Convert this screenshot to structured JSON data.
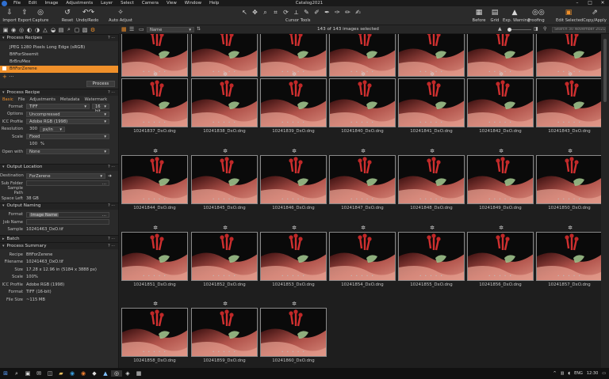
{
  "window": {
    "title": "Catalog2021"
  },
  "menu": [
    "File",
    "Edit",
    "Image",
    "Adjustments",
    "Layer",
    "Select",
    "Camera",
    "View",
    "Window",
    "Help"
  ],
  "toolbar": {
    "left": [
      {
        "label": "Import",
        "icon": "import-icon"
      },
      {
        "label": "Export",
        "icon": "export-icon"
      },
      {
        "label": "Capture",
        "icon": "capture-icon"
      },
      {
        "label": "Reset",
        "icon": "reset-icon"
      },
      {
        "label": "Undo/Redo",
        "icon": "undo-icon"
      },
      {
        "label": "Auto Adjust",
        "icon": "auto-adjust-icon"
      }
    ],
    "cursor_tools_label": "Cursor Tools",
    "right": [
      {
        "label": "Before",
        "icon": "before-icon"
      },
      {
        "label": "Grid",
        "icon": "grid-icon"
      },
      {
        "label": "Exp. Warning",
        "icon": "warning-icon"
      },
      {
        "label": "Proofing",
        "icon": "proofing-icon"
      },
      {
        "label": "Edit Selected",
        "icon": "edit-selected-icon"
      },
      {
        "label": "Copy/Apply",
        "icon": "copy-apply-icon"
      }
    ]
  },
  "browser": {
    "sort": "Name",
    "count": "143 of 143 images selected",
    "search_placeholder": "Search 30 November 2021 1"
  },
  "process_recipes": {
    "title": "Process Recipes",
    "items": [
      "JPEG 1280 Pixels Long Edge (sRGB)",
      "BfiForSteemit",
      "BrBruMex",
      "BfiForZerene"
    ],
    "selected_index": 3,
    "process_label": "Process"
  },
  "process_recipe": {
    "title": "Process Recipe",
    "tabs": [
      "Basic",
      "File",
      "Adjustments",
      "Metadata",
      "Watermark"
    ],
    "format_label": "Format",
    "format": "TIFF",
    "bit_depth": "16 bit",
    "options_label": "Options",
    "options": "Uncompressed",
    "icc_label": "ICC Profile",
    "icc": "Adobe RGB (1998)",
    "resolution_label": "Resolution",
    "resolution": "300",
    "resolution_unit": "px/in",
    "scale_label": "Scale",
    "scale": "Fixed",
    "scale_pct": "100",
    "scale_pct_unit": "%",
    "open_with_label": "Open with",
    "open_with": "None"
  },
  "output_location": {
    "title": "Output Location",
    "destination_label": "Destination",
    "destination": "ForZerene",
    "sub_folder_label": "Sub Folder",
    "sample_path_label": "Sample Path",
    "space_left_label": "Space Left",
    "space_left": "38 GB"
  },
  "output_naming": {
    "title": "Output Naming",
    "format_label": "Format",
    "format_token": "Image Name",
    "job_name_label": "Job Name",
    "sample_label": "Sample",
    "sample": "10241463_DxO.tif"
  },
  "batch": {
    "title": "Batch"
  },
  "process_summary": {
    "title": "Process Summary",
    "rows": [
      {
        "label": "Recipe",
        "value": "BfiForZerene"
      },
      {
        "label": "Filename",
        "value": "10241463_DxO.tif"
      },
      {
        "label": "Size",
        "value": "17.28 x 12.96 in (5184 x 3888 px)"
      },
      {
        "label": "Scale",
        "value": "100%"
      },
      {
        "label": "ICC Profile",
        "value": "Adobe RGB (1998)"
      },
      {
        "label": "Format",
        "value": "TIFF (16-bit)"
      },
      {
        "label": "File Size",
        "value": "~115 MB"
      }
    ]
  },
  "thumbs": [
    [
      "10241830_DxO.dng",
      "10241831_DxO.dng",
      "10241832_DxO.dng",
      "10241833_DxO.dng",
      "10241834_DxO.dng",
      "10241835_DxO.dng",
      "10241836_DxO.dng"
    ],
    [
      "10241837_DxO.dng",
      "10241838_DxO.dng",
      "10241839_DxO.dng",
      "10241840_DxO.dng",
      "10241841_DxO.dng",
      "10241842_DxO.dng",
      "10241843_DxO.dng"
    ],
    [
      "10241844_DxO.dng",
      "10241845_DxO.dng",
      "10241846_DxO.dng",
      "10241847_DxO.dng",
      "10241848_DxO.dng",
      "10241849_DxO.dng",
      "10241850_DxO.dng"
    ],
    [
      "10241851_DxO.dng",
      "10241852_DxO.dng",
      "10241853_DxO.dng",
      "10241854_DxO.dng",
      "10241855_DxO.dng",
      "10241856_DxO.dng",
      "10241857_DxO.dng"
    ],
    [
      "10241858_DxO.dng",
      "10241859_DxO.dng",
      "10241860_DxO.dng"
    ]
  ],
  "taskbar": {
    "lang": "ENG",
    "time": "12:30"
  },
  "colors": {
    "accent": "#f0902a",
    "panel": "#2a2a2a",
    "thumb_bg": "#0b0b0b"
  }
}
